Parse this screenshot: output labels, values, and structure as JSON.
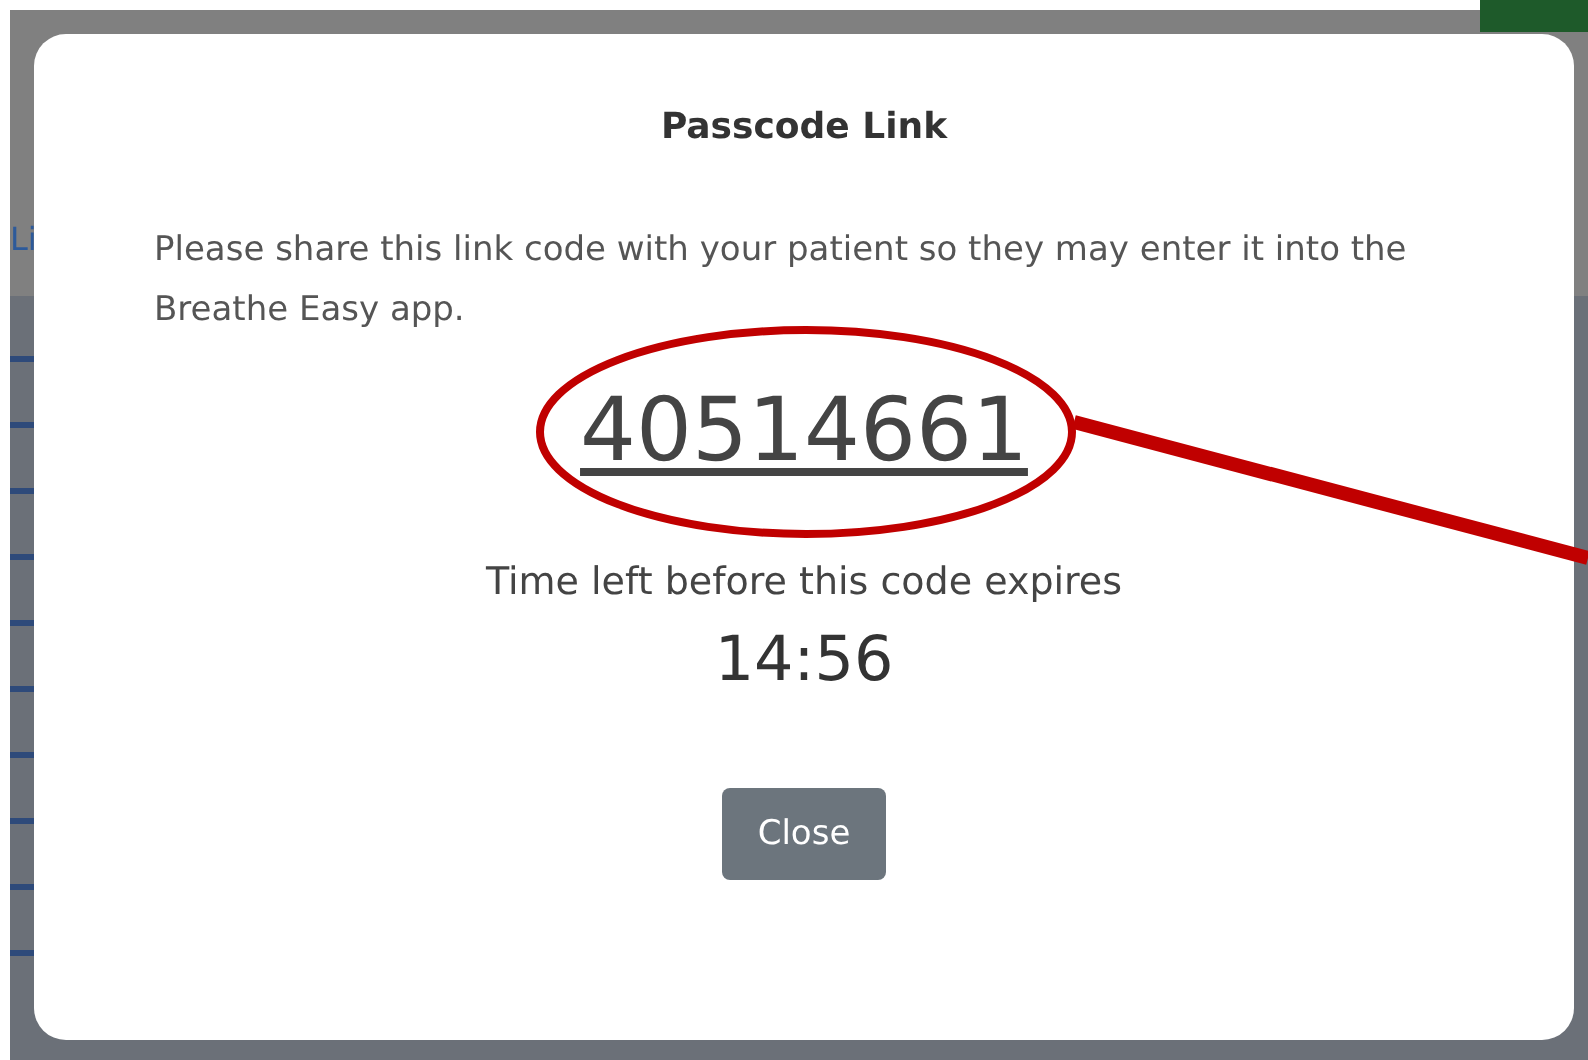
{
  "background": {
    "link": "Li"
  },
  "dialog": {
    "title": "Passcode Link",
    "message": "Please share this link code with your patient so they may enter it into the Breathe Easy app.",
    "code": "40514661",
    "timer_label": "Time left before this code expires",
    "timer": "14:56",
    "close_button": "Close"
  }
}
